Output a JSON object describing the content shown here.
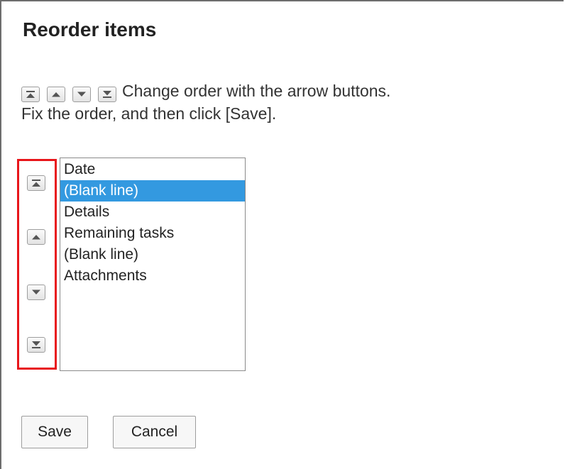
{
  "title": "Reorder items",
  "instructions": {
    "line1": "Change order with the arrow buttons.",
    "line2": "Fix the order, and then click [Save]."
  },
  "icons": [
    "move-to-top-icon",
    "move-up-icon",
    "move-down-icon",
    "move-to-bottom-icon"
  ],
  "colors": {
    "highlight": "#e8161b",
    "selected": "#3399e0"
  },
  "list": {
    "items": [
      "Date",
      "(Blank line)",
      "Details",
      "Remaining tasks",
      "(Blank line)",
      "Attachments"
    ],
    "selected_index": 1
  },
  "buttons": {
    "save": "Save",
    "cancel": "Cancel"
  }
}
